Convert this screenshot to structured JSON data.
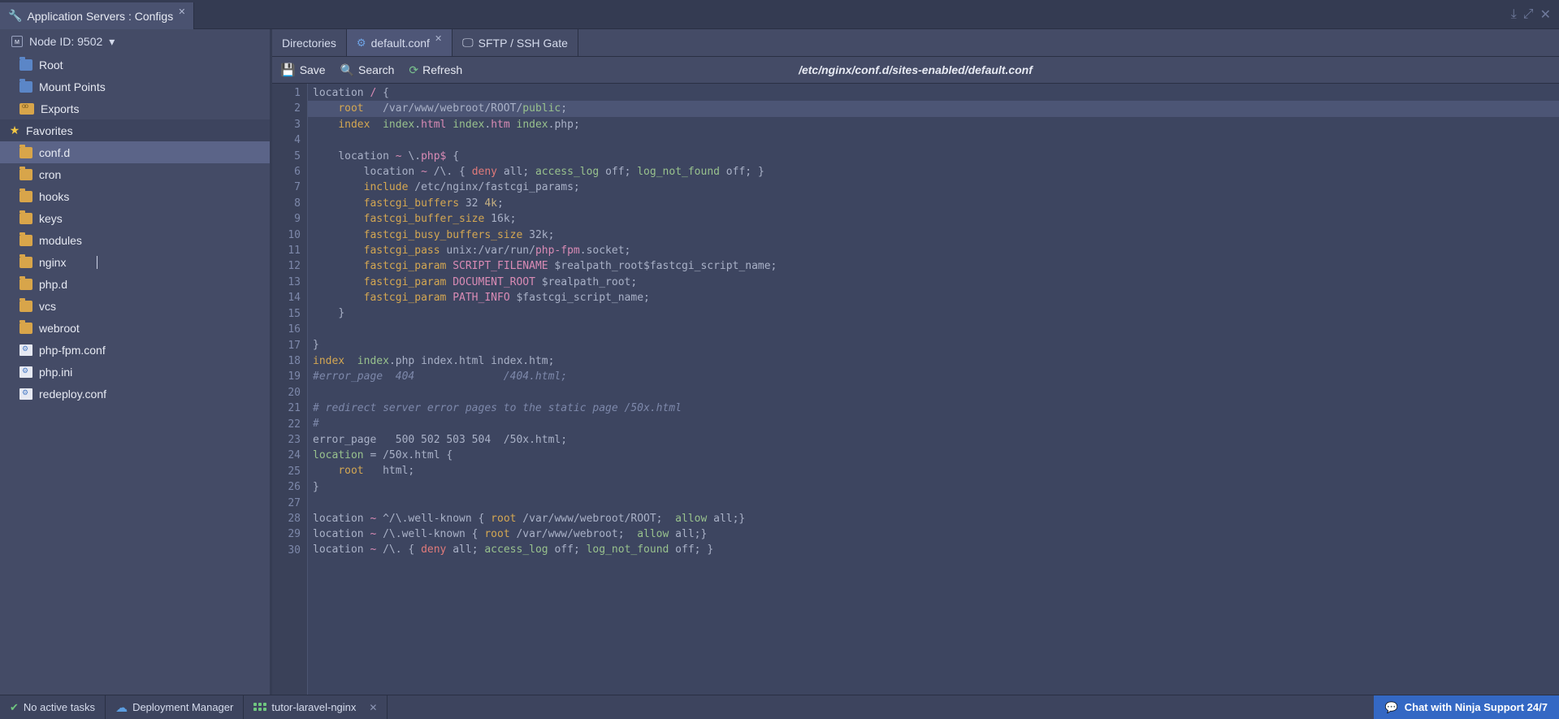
{
  "header": {
    "tab_title": "Application Servers : Configs"
  },
  "node": {
    "label": "Node ID: 9502"
  },
  "tree": {
    "root": "Root",
    "mount": "Mount Points",
    "exports": "Exports",
    "favorites_label": "Favorites",
    "items": [
      {
        "name": "conf.d",
        "type": "folder",
        "active": true
      },
      {
        "name": "cron",
        "type": "folder"
      },
      {
        "name": "hooks",
        "type": "folder"
      },
      {
        "name": "keys",
        "type": "folder"
      },
      {
        "name": "modules",
        "type": "folder"
      },
      {
        "name": "nginx",
        "type": "folder"
      },
      {
        "name": "php.d",
        "type": "folder"
      },
      {
        "name": "vcs",
        "type": "folder"
      },
      {
        "name": "webroot",
        "type": "folder"
      },
      {
        "name": "php-fpm.conf",
        "type": "file"
      },
      {
        "name": "php.ini",
        "type": "file"
      },
      {
        "name": "redeploy.conf",
        "type": "file"
      }
    ]
  },
  "file_tabs": [
    {
      "label": "Directories",
      "active": false,
      "closable": false,
      "icon": null
    },
    {
      "label": "default.conf",
      "active": true,
      "closable": true,
      "icon": "gear"
    },
    {
      "label": "SFTP / SSH Gate",
      "active": false,
      "closable": false,
      "icon": "monitor"
    }
  ],
  "toolbar": {
    "save": "Save",
    "search": "Search",
    "refresh": "Refresh",
    "path": "/etc/nginx/conf.d/sites-enabled/default.conf"
  },
  "code_lines": 30,
  "bottom": {
    "tasks": "No active tasks",
    "deploy": "Deployment Manager",
    "env": "tutor-laravel-nginx",
    "chat": "Chat with Ninja Support 24/7"
  }
}
